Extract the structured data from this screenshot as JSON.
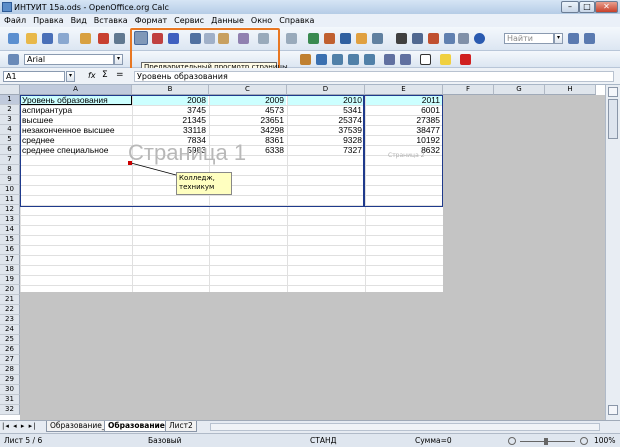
{
  "window": {
    "title": "ИНТУИТ 15a.ods - OpenOffice.org Calc",
    "min": "–",
    "max": "□",
    "close": "✕"
  },
  "menu": [
    "Файл",
    "Правка",
    "Вид",
    "Вставка",
    "Формат",
    "Сервис",
    "Данные",
    "Окно",
    "Справка"
  ],
  "toolbar": {
    "style_box": "Найти",
    "font_name": "Arial",
    "tooltip": "Предварительный просмотр страницы"
  },
  "formula": {
    "cell_ref": "A1",
    "fx": "fx",
    "sigma": "Σ",
    "equals": "=",
    "content": "Уровень образования"
  },
  "columns": [
    "A",
    "B",
    "C",
    "D",
    "E",
    "F",
    "G",
    "H"
  ],
  "rows": [
    "1",
    "2",
    "3",
    "4",
    "5",
    "6",
    "7",
    "8",
    "9",
    "10",
    "11",
    "12",
    "13",
    "14",
    "15",
    "16",
    "17",
    "18",
    "19",
    "20",
    "21",
    "22",
    "23",
    "24",
    "25",
    "26",
    "27",
    "28",
    "29",
    "30",
    "31",
    "32"
  ],
  "table": {
    "header": [
      "Уровень образования",
      "2008",
      "2009",
      "2010",
      "2011"
    ],
    "body": [
      [
        "аспирантура",
        "3745",
        "4573",
        "5341",
        "6001"
      ],
      [
        "высшее",
        "21345",
        "23651",
        "25374",
        "27385"
      ],
      [
        "незаконченное высшее",
        "33118",
        "34298",
        "37539",
        "38477"
      ],
      [
        "среднее",
        "7834",
        "8361",
        "9328",
        "10192"
      ],
      [
        "среднее специальное",
        "5983",
        "6338",
        "7327",
        "8632"
      ]
    ]
  },
  "watermark": "Страница 1",
  "watermark_small": "Страница 2",
  "comment": "Колледж, техникум",
  "sheets": [
    "Образование_2",
    "Образование_3",
    "Лист2"
  ],
  "status": {
    "sheet": "Лист 5 / 6",
    "style": "Базовый",
    "mode": "СТАНД",
    "sum": "Сумма=0",
    "zoom": "100%"
  },
  "colors": {
    "header_fill": "#ccffff",
    "selection": "#1f3a8c",
    "highlight": "#e87722"
  }
}
